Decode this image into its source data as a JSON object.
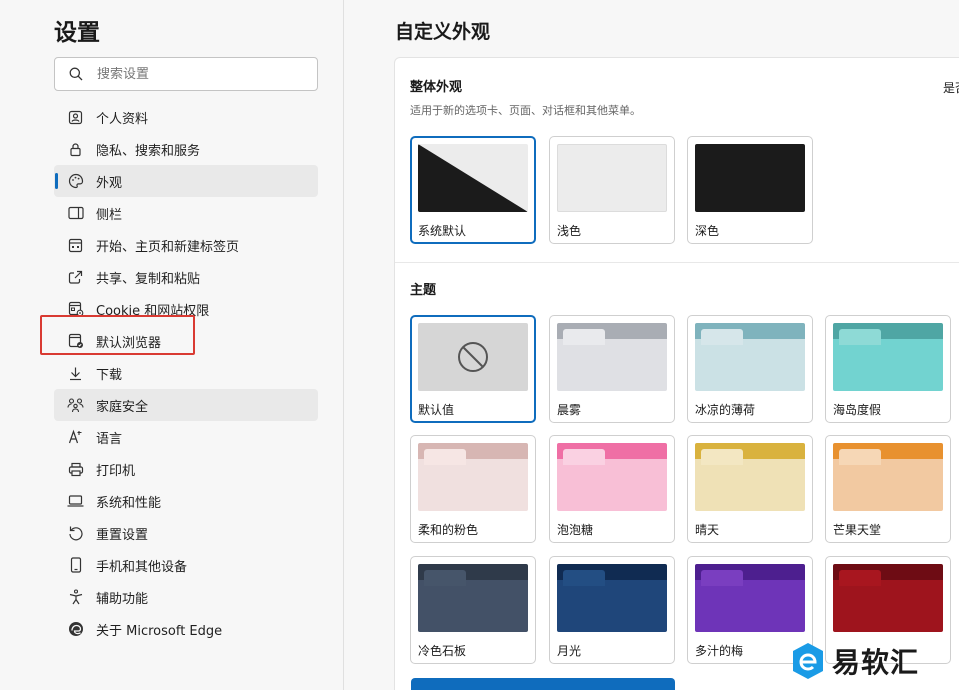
{
  "sidebar": {
    "title": "设置",
    "search_placeholder": "搜索设置",
    "items": [
      {
        "label": "个人资料",
        "icon": "profile-icon"
      },
      {
        "label": "隐私、搜索和服务",
        "icon": "lock-icon"
      },
      {
        "label": "外观",
        "icon": "palette-icon"
      },
      {
        "label": "侧栏",
        "icon": "sidebar-icon"
      },
      {
        "label": "开始、主页和新建标签页",
        "icon": "home-grid-icon"
      },
      {
        "label": "共享、复制和粘贴",
        "icon": "share-icon"
      },
      {
        "label": "Cookie 和网站权限",
        "icon": "cookie-icon"
      },
      {
        "label": "默认浏览器",
        "icon": "browser-icon"
      },
      {
        "label": "下载",
        "icon": "download-icon"
      },
      {
        "label": "家庭安全",
        "icon": "family-icon"
      },
      {
        "label": "语言",
        "icon": "language-icon"
      },
      {
        "label": "打印机",
        "icon": "printer-icon"
      },
      {
        "label": "系统和性能",
        "icon": "laptop-icon"
      },
      {
        "label": "重置设置",
        "icon": "reset-icon"
      },
      {
        "label": "手机和其他设备",
        "icon": "phone-icon"
      },
      {
        "label": "辅助功能",
        "icon": "accessibility-icon"
      },
      {
        "label": "关于 Microsoft Edge",
        "icon": "edge-icon"
      }
    ]
  },
  "main": {
    "title": "自定义外观",
    "overall": {
      "heading": "整体外观",
      "subtitle": "适用于新的选项卡、页面、对话框和其他菜单。",
      "right_text": "是否",
      "options": [
        "系统默认",
        "浅色",
        "深色"
      ]
    },
    "themes": {
      "heading": "主题",
      "items": [
        {
          "label": "默认值",
          "tab": "#d6d6d6",
          "flap": "#d6d6d6",
          "body": "#d6d6d6"
        },
        {
          "label": "晨雾",
          "tab": "#a9adb4",
          "flap": "#e9eaed",
          "body": "#dfe0e4"
        },
        {
          "label": "冰凉的薄荷",
          "tab": "#7fb3bd",
          "flap": "#d6e6ea",
          "body": "#cbe1e5"
        },
        {
          "label": "海岛度假",
          "tab": "#4fa6a4",
          "flap": "#8edad6",
          "body": "#72d3d0"
        },
        {
          "label": "柔和的粉色",
          "tab": "#d7b6b3",
          "flap": "#f6e6e4",
          "body": "#f0e0df"
        },
        {
          "label": "泡泡糖",
          "tab": "#ef6fa5",
          "flap": "#fad1e2",
          "body": "#f8bfd6"
        },
        {
          "label": "晴天",
          "tab": "#d9b23e",
          "flap": "#f3e7c2",
          "body": "#efe1b6"
        },
        {
          "label": "芒果天堂",
          "tab": "#e8912f",
          "flap": "#f6d7b6",
          "body": "#f2c9a1"
        },
        {
          "label": "冷色石板",
          "tab": "#2f3a4a",
          "flap": "#46556a",
          "body": "#435167"
        },
        {
          "label": "月光",
          "tab": "#102b52",
          "flap": "#234e83",
          "body": "#1f467a"
        },
        {
          "label": "多汁的梅",
          "tab": "#4d1f8f",
          "flap": "#7a3ec0",
          "body": "#6e34b8"
        },
        {
          "label": "",
          "tab": "#6e0c14",
          "flap": "#a8161f",
          "body": "#9e141d"
        }
      ]
    }
  },
  "watermark": {
    "text": "易软汇"
  },
  "colors": {
    "accent": "#0f6cbd",
    "highlight": "#d93a32"
  }
}
